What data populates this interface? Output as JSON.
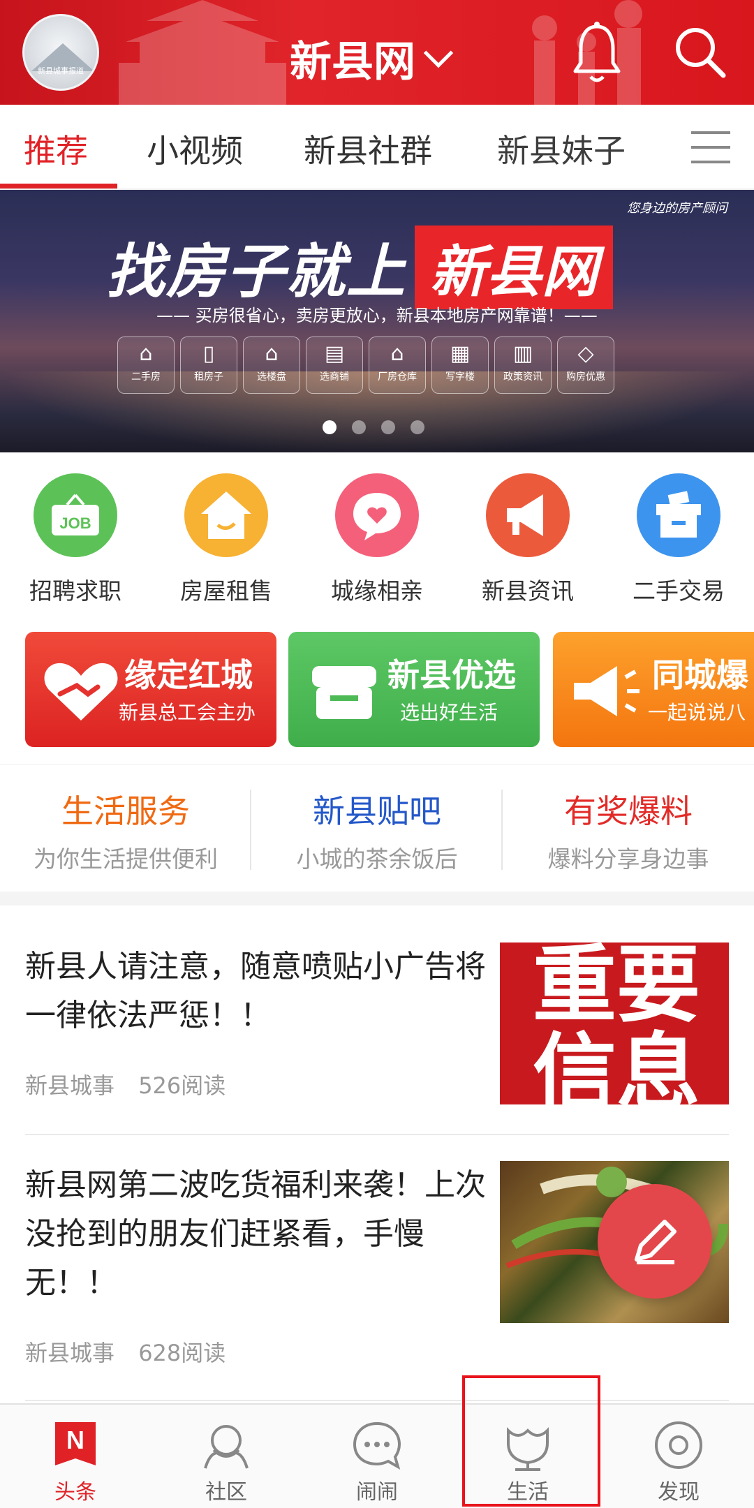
{
  "header": {
    "avatar_caption": "新县城事报道",
    "title": "新县网"
  },
  "tabs": [
    {
      "label": "推荐",
      "active": true
    },
    {
      "label": "小视频"
    },
    {
      "label": "新县社群"
    },
    {
      "label": "新县妹子"
    }
  ],
  "banner": {
    "tag": "您身边的房产顾问",
    "headline_main": "找房子就上",
    "headline_brand": "新县网",
    "subline": "—— 买房很省心，卖房更放心，新县本地房产网靠谱！——",
    "icons": [
      {
        "label": "二手房",
        "icon": "house-icon"
      },
      {
        "label": "租房子",
        "icon": "door-icon"
      },
      {
        "label": "选楼盘",
        "icon": "home-icon"
      },
      {
        "label": "选商铺",
        "icon": "shop-icon"
      },
      {
        "label": "厂房仓库",
        "icon": "warehouse-icon"
      },
      {
        "label": "写字楼",
        "icon": "office-icon"
      },
      {
        "label": "政策资讯",
        "icon": "policy-icon"
      },
      {
        "label": "购房优惠",
        "icon": "tag-icon"
      }
    ],
    "slide_index": 1,
    "slide_count": 4
  },
  "quick_links": [
    {
      "label": "招聘求职",
      "color": "#5cc257",
      "icon": "job-icon"
    },
    {
      "label": "房屋租售",
      "color": "#f7b133",
      "icon": "house-icon"
    },
    {
      "label": "城缘相亲",
      "color": "#f4607a",
      "icon": "heart-chat-icon"
    },
    {
      "label": "新县资讯",
      "color": "#ec5a3c",
      "icon": "megaphone-icon"
    },
    {
      "label": "二手交易",
      "color": "#3d94ee",
      "icon": "box-icon"
    }
  ],
  "promos": [
    {
      "title": "缘定红城",
      "subtitle": "新县总工会主办",
      "color": "#e5322f"
    },
    {
      "title": "新县优选",
      "subtitle": "选出好生活",
      "color": "#4dba56"
    },
    {
      "title": "同城爆",
      "subtitle": "一起说说八",
      "color": "#f98a1c"
    }
  ],
  "sections": [
    {
      "title": "生活服务",
      "subtitle": "为你生活提供便利",
      "color": "#f06a13"
    },
    {
      "title": "新县贴吧",
      "subtitle": "小城的茶余饭后",
      "color": "#2458c9"
    },
    {
      "title": "有奖爆料",
      "subtitle": "爆料分享身边事",
      "color": "#e22b28"
    }
  ],
  "articles": [
    {
      "title": "新县人请注意，随意喷贴小广告将一律依法严惩！！",
      "source": "新县城事",
      "reads": "526阅读",
      "thumb_text_1": "重要",
      "thumb_text_2": "信息"
    },
    {
      "title": "新县网第二波吃货福利来袭！上次没抢到的朋友们赶紧看，手慢无！！",
      "source": "新县城事",
      "reads": "628阅读"
    }
  ],
  "bottom_nav": [
    {
      "label": "头条",
      "active": true
    },
    {
      "label": "社区"
    },
    {
      "label": "闹闹"
    },
    {
      "label": "生活"
    },
    {
      "label": "发现"
    }
  ],
  "colors": {
    "brand_red": "#e02227",
    "header_red": "#d8171d",
    "highlight_box": "#e8141c"
  }
}
